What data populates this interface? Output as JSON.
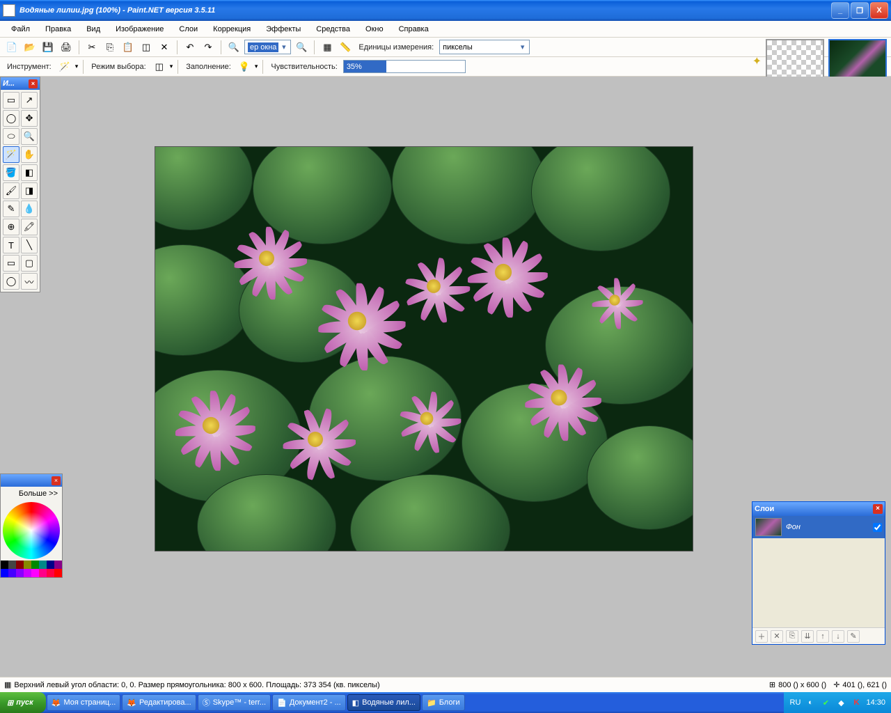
{
  "window": {
    "title": "Водяные лилии.jpg (100%) - Paint.NET версия 3.5.11",
    "min": "_",
    "max": "❐",
    "close": "X"
  },
  "menu": [
    "Файл",
    "Правка",
    "Вид",
    "Изображение",
    "Слои",
    "Коррекция",
    "Эффекты",
    "Средства",
    "Окно",
    "Справка"
  ],
  "toolbar1": {
    "zoom_combo": "ер окна",
    "units_label": "Единицы измерения:",
    "units_value": "пикселы"
  },
  "toolbar2": {
    "tool_label": "Инструмент:",
    "mode_label": "Режим выбора:",
    "fill_label": "Заполнение:",
    "sens_label": "Чувствительность:",
    "sens_value": "35%",
    "sens_pct": 35
  },
  "toolbox_title": "И...",
  "colors": {
    "more": "Больше >>"
  },
  "layers": {
    "title": "Слои",
    "layer0": "Фон"
  },
  "status": {
    "sel": "Верхний левый угол области: 0, 0. Размер прямоугольника: 800 x 600. Площадь: 373 354 (кв. пикселы)",
    "size": "800 () x 600 ()",
    "pos": "401 (), 621 ()"
  },
  "taskbar": {
    "start": "пуск",
    "items": [
      "Моя страниц...",
      "Редактирова...",
      "Skype™ - terr...",
      "Документ2 - ...",
      "Водяные лил...",
      "Блоги"
    ],
    "lang": "RU",
    "clock": "14:30"
  }
}
